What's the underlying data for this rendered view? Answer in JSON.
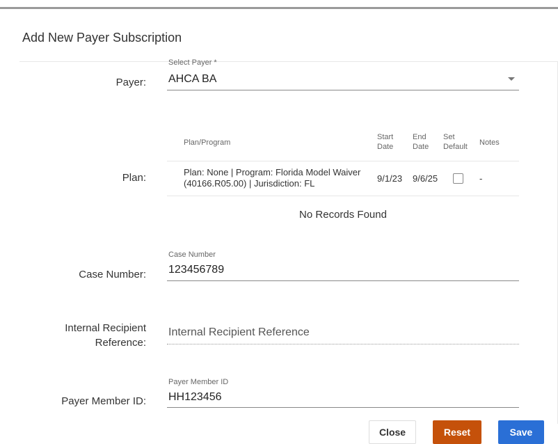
{
  "dialog": {
    "title": "Add New Payer Subscription"
  },
  "payer": {
    "label": "Payer:",
    "float_label": "Select Payer *",
    "value": "AHCA BA"
  },
  "plan": {
    "label": "Plan:",
    "columns": {
      "plan_program": "Plan/Program",
      "start_date_1": "Start",
      "start_date_2": "Date",
      "end_date_1": "End",
      "end_date_2": "Date",
      "set_default_1": "Set",
      "set_default_2": "Default",
      "notes": "Notes"
    },
    "rows": [
      {
        "plan_program_line1": "Plan: None | Program: Florida Model Waiver",
        "plan_program_line2": "(40166.R05.00) | Jurisdiction: FL",
        "start_date": "9/1/23",
        "end_date": "9/6/25",
        "set_default": false,
        "notes": "-"
      }
    ],
    "empty_message": "No Records Found"
  },
  "case_number": {
    "label": "Case Number:",
    "float_label": "Case Number",
    "value": "123456789"
  },
  "internal_ref": {
    "label_line1": "Internal Recipient",
    "label_line2": "Reference:",
    "placeholder": "Internal Recipient Reference"
  },
  "payer_member_id": {
    "label": "Payer Member ID:",
    "float_label": "Payer Member ID",
    "value": "HH123456"
  },
  "buttons": {
    "close": "Close",
    "reset": "Reset",
    "save": "Save"
  },
  "colors": {
    "reset_button": "#c5510a",
    "save_button": "#2a6fd6"
  }
}
